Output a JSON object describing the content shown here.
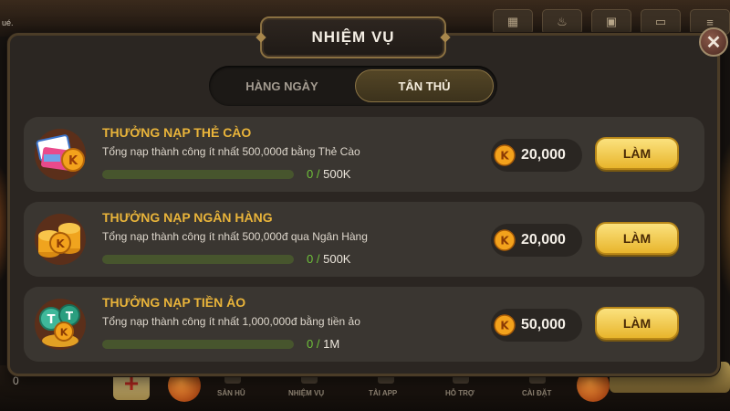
{
  "background": {
    "top_text": "ué.",
    "balance_fragment": "0",
    "nav_labels": [
      "SẢN HŨ",
      "NHIỆM VỤ",
      "TẢI APP",
      "HỖ TRỢ",
      "CÀI ĐẶT"
    ]
  },
  "modal": {
    "title": "NHIỆM VỤ",
    "close_symbol": "✕",
    "tabs": [
      {
        "label": "HÀNG NGÀY",
        "active": false
      },
      {
        "label": "TÂN THỦ",
        "active": true
      }
    ],
    "tasks": [
      {
        "title": "THƯỞNG NẠP THẺ CÀO",
        "description": "Tổng nạp thành công ít nhất 500,000đ bằng Thẻ Cào",
        "progress_current": "0",
        "progress_separator": "/",
        "progress_total": "500K",
        "progress_fraction": 0,
        "reward": "20,000",
        "button_label": "LÀM",
        "icon": "scratch-card-icon"
      },
      {
        "title": "THƯỞNG NẠP NGÂN HÀNG",
        "description": "Tổng nạp thành công ít nhất 500,000đ qua Ngân Hàng",
        "progress_current": "0",
        "progress_separator": "/",
        "progress_total": "500K",
        "progress_fraction": 0,
        "reward": "20,000",
        "button_label": "LÀM",
        "icon": "coin-stack-icon"
      },
      {
        "title": "THƯỞNG NẠP TIỀN ẢO",
        "description": "Tổng nạp thành công ít nhất 1,000,000đ bằng tiền ảo",
        "progress_current": "0",
        "progress_separator": "/",
        "progress_total": "1M",
        "progress_fraction": 0,
        "reward": "50,000",
        "button_label": "LÀM",
        "icon": "crypto-coin-icon"
      }
    ]
  },
  "colors": {
    "accent_gold": "#e9b43a",
    "progress_green": "#7ab83c",
    "button_gold": "#f5cd4a",
    "panel_bg": "#2b2622"
  }
}
